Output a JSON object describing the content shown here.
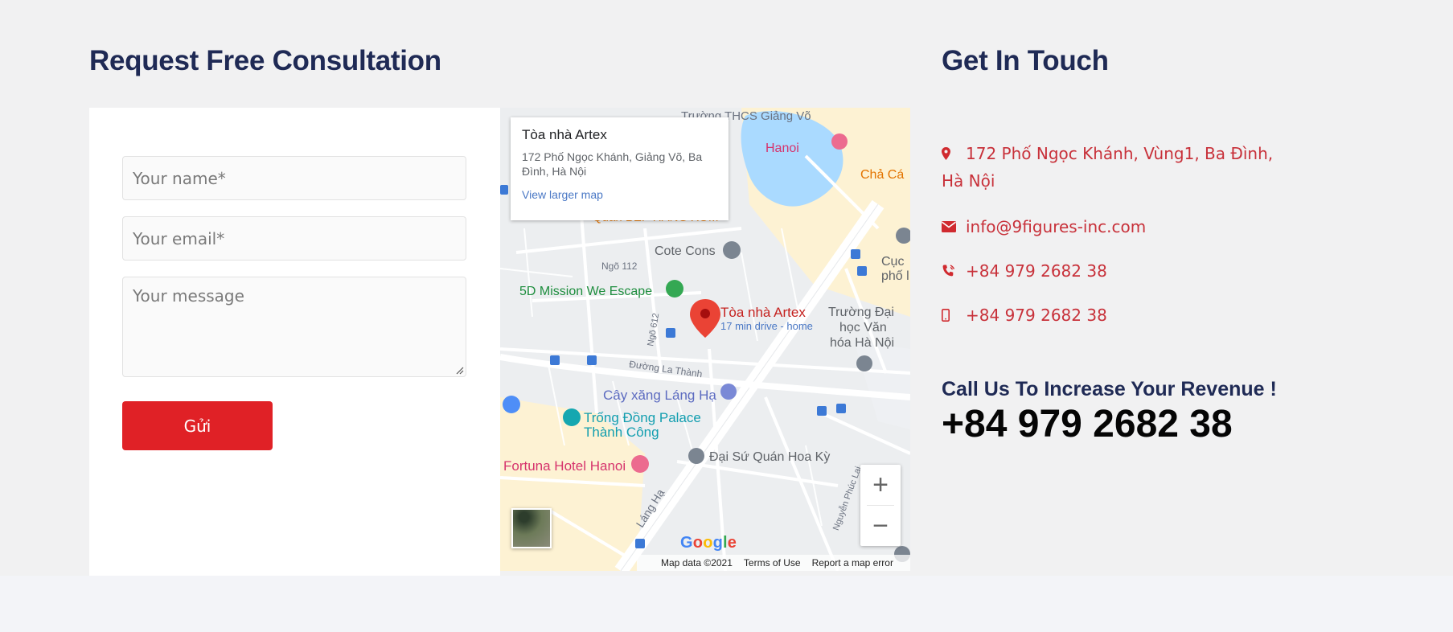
{
  "consultation": {
    "title": "Request Free Consultation",
    "name_placeholder": "Your name*",
    "email_placeholder": "Your email*",
    "message_placeholder": "Your message",
    "submit_label": "Gửi"
  },
  "map": {
    "info": {
      "title": "Tòa nhà Artex",
      "address": "172 Phố Ngọc Khánh, Giảng Võ, Ba Đình, Hà Nội",
      "view_larger": "View larger map"
    },
    "labels": {
      "school_top": "Trường THCS Giảng Võ",
      "hanoi_hotel": "Hanoi",
      "cha_ca": "Chả Cá",
      "quan": "Quán BẾP HÀNG XÓM",
      "cote_cons": "Cote Cons",
      "ngo112": "Ngõ 112",
      "escape": "5D Mission We Escape",
      "artex_pin": "Tòa nhà Artex",
      "drive": "17 min drive - home",
      "cuc": "Cục",
      "pho": "phố l",
      "truong_dai": "Trường Đại",
      "hoc_van": "học Văn",
      "hoa_hn": "hóa Hà Nội",
      "ngo612": "Ngõ 612",
      "duong_la_thanh": "Đường La Thành",
      "cay_xang": "Cây xăng Láng Hạ",
      "trong_dong_1": "Trống Đồng Palace",
      "trong_dong_2": "Thành Công",
      "fortuna": "Fortuna Hotel Hanoi",
      "dai_su_quan": "Đại Sứ Quán Hoa Kỳ",
      "lang_ha": "Láng Hạ",
      "nguyen_phuc_lai": "Nguyễn Phúc Lai"
    },
    "zoom_in": "+",
    "zoom_out": "−",
    "attribution": {
      "data": "Map data ©2021",
      "terms": "Terms of Use",
      "report": "Report a map error"
    },
    "colors": {
      "water": "#aadaff",
      "road": "#ffffff",
      "block": "#f8f0d6",
      "pin": "#ea4335"
    }
  },
  "contact": {
    "title": "Get In Touch",
    "address": "172 Phố Ngọc Khánh, Vùng1, Ba Đình, Hà Nội",
    "email": "info@9figures-inc.com",
    "phone1": "+84 979 2682 38",
    "phone2": "+84 979 2682 38",
    "icons": [
      "map-marker-icon",
      "envelope-icon",
      "phone-volume-icon",
      "mobile-icon"
    ],
    "accent": "#c8313a"
  },
  "call": {
    "title": "Call Us To Increase Your Revenue !",
    "phone": "+84 979 2682 38"
  }
}
